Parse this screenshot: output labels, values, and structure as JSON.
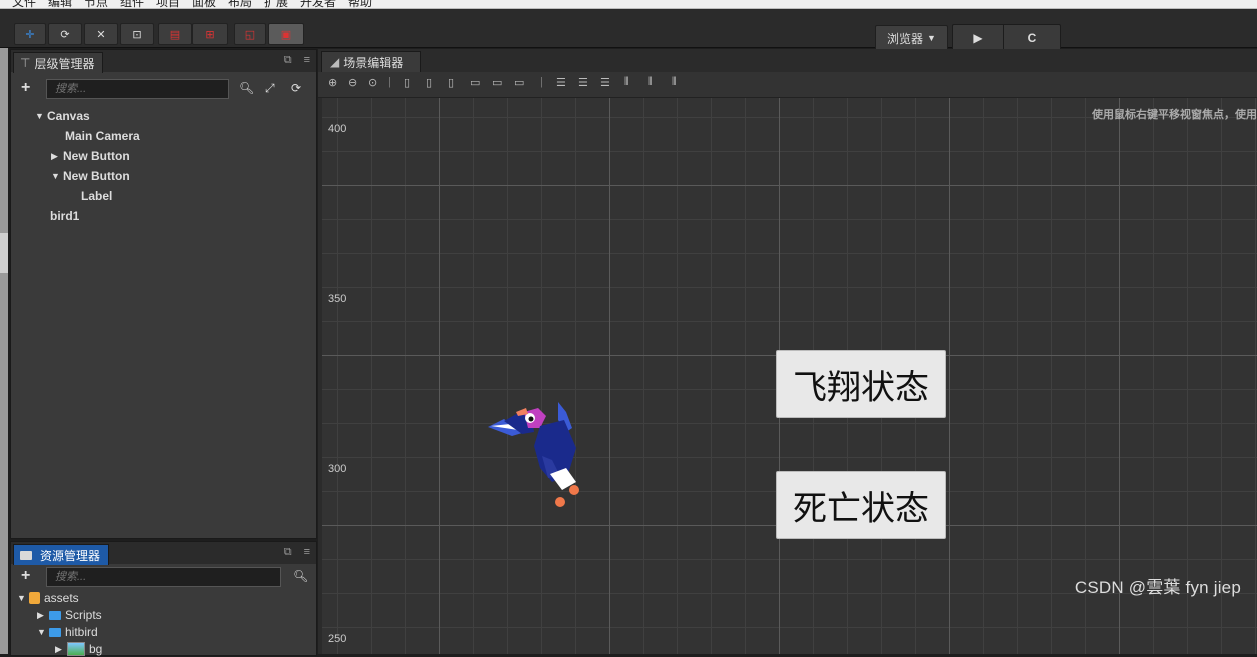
{
  "menu": [
    "文件",
    "编辑",
    "节点",
    "组件",
    "项目",
    "面板",
    "布局",
    "扩展",
    "开发者",
    "帮助"
  ],
  "toolbar": {
    "preview_target": "浏览器",
    "dropdown_arrow": "▼",
    "play_icon": "▶",
    "reload_icon": "C"
  },
  "hierarchy": {
    "tab_label": "层级管理器",
    "search_placeholder": "搜索...",
    "items": [
      {
        "label": "Canvas",
        "arrow": "▼"
      },
      {
        "label": "Main Camera",
        "arrow": ""
      },
      {
        "label": "New Button",
        "arrow": "▶"
      },
      {
        "label": "New Button",
        "arrow": "▼"
      },
      {
        "label": "Label",
        "arrow": ""
      },
      {
        "label": "bird1",
        "arrow": ""
      }
    ]
  },
  "assets": {
    "tab_label": "资源管理器",
    "search_placeholder": "搜索...",
    "items": [
      {
        "label": "assets",
        "arrow": "▼"
      },
      {
        "label": "Scripts",
        "arrow": "▶"
      },
      {
        "label": "hitbird",
        "arrow": "▼"
      },
      {
        "label": "bg",
        "arrow": "▶"
      }
    ]
  },
  "scene": {
    "tab_label": "场景编辑器",
    "hint": "使用鼠标右键平移视窗焦点，使用",
    "ruler": [
      "400",
      "350",
      "300",
      "250"
    ],
    "buttons": [
      "飞翔状态",
      "死亡状态"
    ]
  },
  "watermark": "CSDN @雲葉 fyn jiep",
  "colors": {
    "accent": "#1e5aa7",
    "folder": "#3d9be9",
    "bird_body": "#1a2a8c",
    "bird_head": "#c040c0"
  }
}
